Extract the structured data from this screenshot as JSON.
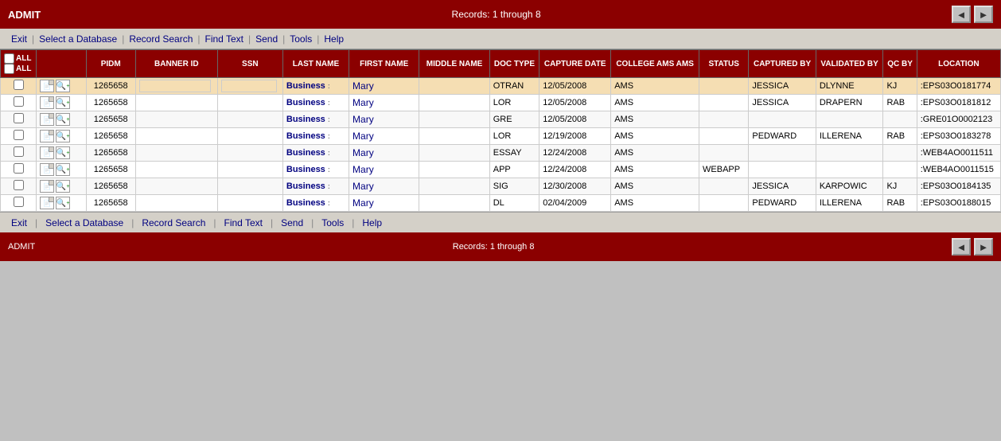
{
  "topBar": {
    "title": "ADMIT",
    "records": "Records: 1 through 8"
  },
  "bottomBar": {
    "title": "ADMIT",
    "records": "Records: 1 through 8"
  },
  "menu": {
    "items": [
      "Exit",
      "Select a Database",
      "Record Search",
      "Find Text",
      "Send",
      "Tools",
      "Help"
    ]
  },
  "table": {
    "headers": [
      "",
      "",
      "PIDM",
      "BANNER ID",
      "SSN",
      "LAST NAME",
      "FIRST NAME",
      "MIDDLE NAME",
      "DOC TYPE",
      "CAPTURE DATE",
      "COLLEGE",
      "STATUS",
      "CAPTURED BY",
      "VALIDATED BY",
      "QC BY",
      "LOCATION"
    ],
    "rows": [
      {
        "highlighted": true,
        "pidm": "1265658",
        "bannerid": "",
        "ssn": "",
        "lastname": "Business",
        "firstname": "Mary",
        "middlename": "",
        "doctype": "OTRAN",
        "capturedate": "12/05/2008",
        "college": "AMS",
        "status": "",
        "capturedby": "JESSICA",
        "validatedby": "DLYNNE",
        "qcby": "KJ",
        "location": ":EPS03O0181774"
      },
      {
        "highlighted": false,
        "pidm": "1265658",
        "bannerid": "",
        "ssn": "",
        "lastname": "Business",
        "firstname": "Mary",
        "middlename": "",
        "doctype": "LOR",
        "capturedate": "12/05/2008",
        "college": "AMS",
        "status": "",
        "capturedby": "JESSICA",
        "validatedby": "DRAPERN",
        "qcby": "RAB",
        "location": ":EPS03O0181812"
      },
      {
        "highlighted": false,
        "pidm": "1265658",
        "bannerid": "",
        "ssn": "",
        "lastname": "Business",
        "firstname": "Mary",
        "middlename": "",
        "doctype": "GRE",
        "capturedate": "12/05/2008",
        "college": "AMS",
        "status": "",
        "capturedby": "",
        "validatedby": "",
        "qcby": "",
        "location": ":GRE01O0002123"
      },
      {
        "highlighted": false,
        "pidm": "1265658",
        "bannerid": "",
        "ssn": "",
        "lastname": "Business",
        "firstname": "Mary",
        "middlename": "",
        "doctype": "LOR",
        "capturedate": "12/19/2008",
        "college": "AMS",
        "status": "",
        "capturedby": "PEDWARD",
        "validatedby": "ILLERENA",
        "qcby": "RAB",
        "location": ":EPS03O0183278"
      },
      {
        "highlighted": false,
        "pidm": "1265658",
        "bannerid": "",
        "ssn": "",
        "lastname": "Business",
        "firstname": "Mary",
        "middlename": "",
        "doctype": "ESSAY",
        "capturedate": "12/24/2008",
        "college": "AMS",
        "status": "",
        "capturedby": "",
        "validatedby": "",
        "qcby": "",
        "location": ":WEB4AO0011511"
      },
      {
        "highlighted": false,
        "pidm": "1265658",
        "bannerid": "",
        "ssn": "",
        "lastname": "Business",
        "firstname": "Mary",
        "middlename": "",
        "doctype": "APP",
        "capturedate": "12/24/2008",
        "college": "AMS",
        "status": "WEBAPP",
        "capturedby": "",
        "validatedby": "",
        "qcby": "",
        "location": ":WEB4AO0011515"
      },
      {
        "highlighted": false,
        "pidm": "1265658",
        "bannerid": "",
        "ssn": "",
        "lastname": "Business",
        "firstname": "Mary",
        "middlename": "",
        "doctype": "SIG",
        "capturedate": "12/30/2008",
        "college": "AMS",
        "status": "",
        "capturedby": "JESSICA",
        "validatedby": "KARPOWIC",
        "qcby": "KJ",
        "location": ":EPS03O0184135"
      },
      {
        "highlighted": false,
        "pidm": "1265658",
        "bannerid": "",
        "ssn": "",
        "lastname": "Business",
        "firstname": "Mary",
        "middlename": "",
        "doctype": "DL",
        "capturedate": "02/04/2009",
        "college": "AMS",
        "status": "",
        "capturedby": "PEDWARD",
        "validatedby": "ILLERENA",
        "qcby": "RAB",
        "location": ":EPS03O0188015"
      }
    ]
  },
  "checkboxAll": {
    "allLabel": "ALL",
    "noneLabel": "ALL"
  },
  "arrows": {
    "left": "◄",
    "right": "►"
  }
}
